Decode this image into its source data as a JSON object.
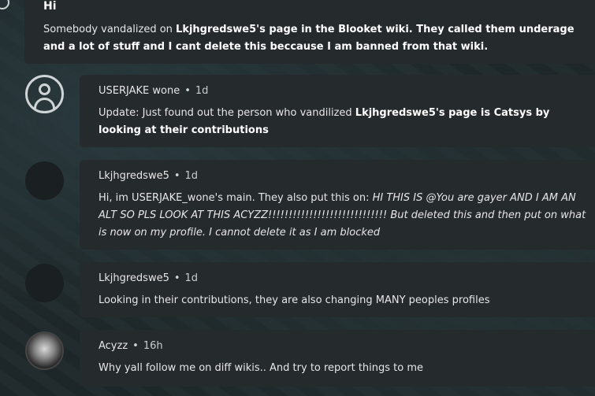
{
  "post": {
    "title": "Hi",
    "body_prefix": "Somebody vandalized on ",
    "body_bold": "Lkjhgredswe5's page in the Blooket wiki. They called them underage and a lot of stuff and I cant delete this beccause I am banned from that wiki."
  },
  "replies": [
    {
      "author": "USERJAKE wone",
      "time": "1d",
      "avatar": "default-avatar-icon",
      "text_prefix": "Update: Just found out the person who vandilized ",
      "text_bold": "Lkjhgredswe5's page is Catsys by looking at their contributions"
    },
    {
      "author": "Lkjhgredswe5",
      "time": "1d",
      "avatar": "dark-avatar",
      "text_prefix": "Hi, im USERJAKE_wone's main. They also put this on: ",
      "text_italic": "HI THIS IS @You are gayer AND I AM AN ALT SO PLS LOOK AT THIS ACYZZ!!!!!!!!!!!!!!!!!!!!!!!!!!!!! But deleted this and then put on what is now on my profile. I cannot delete it as I am blocked"
    },
    {
      "author": "Lkjhgredswe5",
      "time": "1d",
      "avatar": "dark-avatar",
      "text": "Looking in their contributions, they are also changing MANY peoples profiles"
    },
    {
      "author": "Acyzz",
      "time": "16h",
      "avatar": "photo-avatar",
      "text": "Why yall follow me on diff wikis.. And try to report things to me"
    }
  ]
}
